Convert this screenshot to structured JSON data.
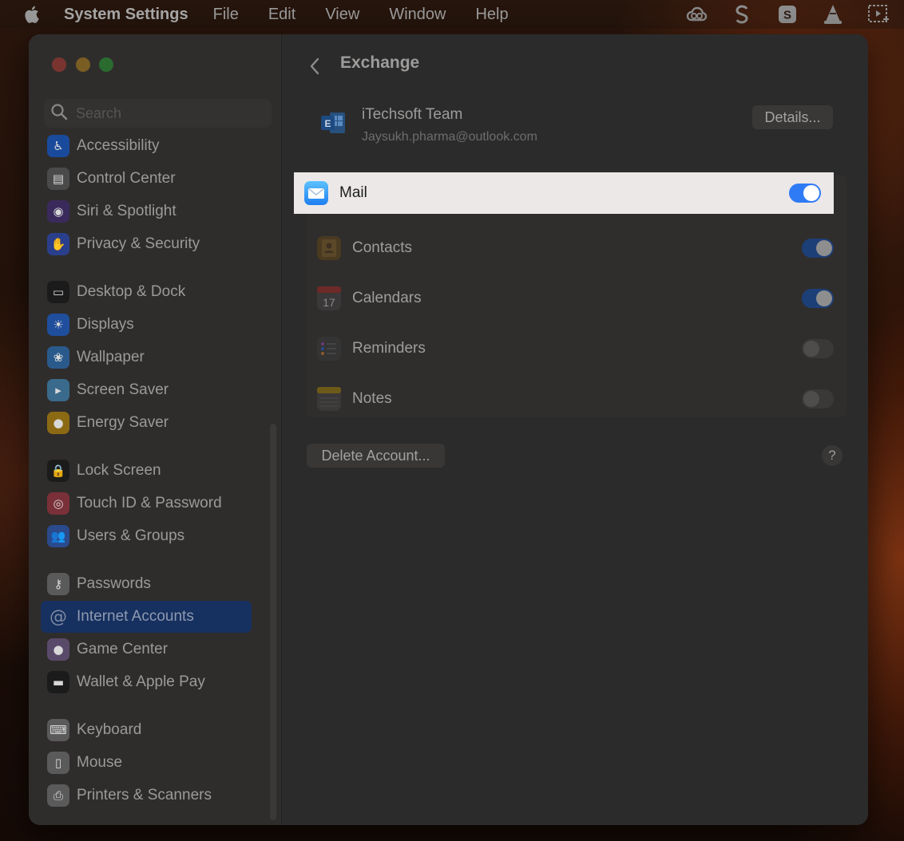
{
  "menubar": {
    "app_name": "System Settings",
    "items": [
      "File",
      "Edit",
      "View",
      "Window",
      "Help"
    ],
    "status_icons": [
      "creative-cloud-icon",
      "scrivener-icon",
      "skype-icon",
      "vlc-icon",
      "screenshot-icon"
    ]
  },
  "sidebar": {
    "search_placeholder": "Search",
    "items": [
      {
        "label": "Accessibility",
        "icon": "accessibility-icon",
        "color": "#1a4a9c",
        "active": false
      },
      {
        "label": "Control Center",
        "icon": "control-center-icon",
        "color": "#4a4a4a",
        "active": false
      },
      {
        "label": "Siri & Spotlight",
        "icon": "siri-icon",
        "color": "#3a2a5c",
        "active": false
      },
      {
        "label": "Privacy & Security",
        "icon": "hand-icon",
        "color": "#2a3f8c",
        "active": false
      },
      {
        "label": "Desktop & Dock",
        "icon": "dock-icon",
        "color": "#1b1b1b",
        "active": false
      },
      {
        "label": "Displays",
        "icon": "sun-icon",
        "color": "#1f4e9c",
        "active": false
      },
      {
        "label": "Wallpaper",
        "icon": "wallpaper-icon",
        "color": "#2a5a8c",
        "active": false
      },
      {
        "label": "Screen Saver",
        "icon": "screen-saver-icon",
        "color": "#3a6a8c",
        "active": false
      },
      {
        "label": "Energy Saver",
        "icon": "bulb-icon",
        "color": "#8c6a14",
        "active": false
      },
      {
        "label": "Lock Screen",
        "icon": "lock-icon",
        "color": "#1b1b1b",
        "active": false
      },
      {
        "label": "Touch ID & Password",
        "icon": "fingerprint-icon",
        "color": "#7a3038",
        "active": false
      },
      {
        "label": "Users & Groups",
        "icon": "users-icon",
        "color": "#2a4a8c",
        "active": false
      },
      {
        "label": "Passwords",
        "icon": "key-icon",
        "color": "#5a5a5a",
        "active": false
      },
      {
        "label": "Internet Accounts",
        "icon": "at-icon",
        "color": "#1a3e7a",
        "active": true
      },
      {
        "label": "Game Center",
        "icon": "game-center-icon",
        "color": "#5a4a6a",
        "active": false
      },
      {
        "label": "Wallet & Apple Pay",
        "icon": "wallet-icon",
        "color": "#1b1b1b",
        "active": false
      },
      {
        "label": "Keyboard",
        "icon": "keyboard-icon",
        "color": "#5a5a5a",
        "active": false
      },
      {
        "label": "Mouse",
        "icon": "mouse-icon",
        "color": "#5a5a5a",
        "active": false
      },
      {
        "label": "Printers & Scanners",
        "icon": "printer-icon",
        "color": "#5a5a5a",
        "active": false
      }
    ]
  },
  "content": {
    "title": "Exchange",
    "account": {
      "name": "iTechsoft Team",
      "email": "Jaysukh.pharma@outlook.com",
      "details_label": "Details..."
    },
    "services": [
      {
        "label": "Mail",
        "icon": "mail-icon",
        "enabled": true,
        "highlight": true
      },
      {
        "label": "Contacts",
        "icon": "contacts-icon",
        "enabled": true,
        "highlight": false
      },
      {
        "label": "Calendars",
        "icon": "calendar-icon",
        "enabled": true,
        "highlight": false,
        "icon_text": "17"
      },
      {
        "label": "Reminders",
        "icon": "reminders-icon",
        "enabled": false,
        "highlight": false
      },
      {
        "label": "Notes",
        "icon": "notes-icon",
        "enabled": false,
        "highlight": false
      }
    ],
    "delete_label": "Delete Account...",
    "help_label": "?"
  },
  "colors": {
    "accent": "#2f7bf5",
    "sidebar_active": "#16305f"
  }
}
